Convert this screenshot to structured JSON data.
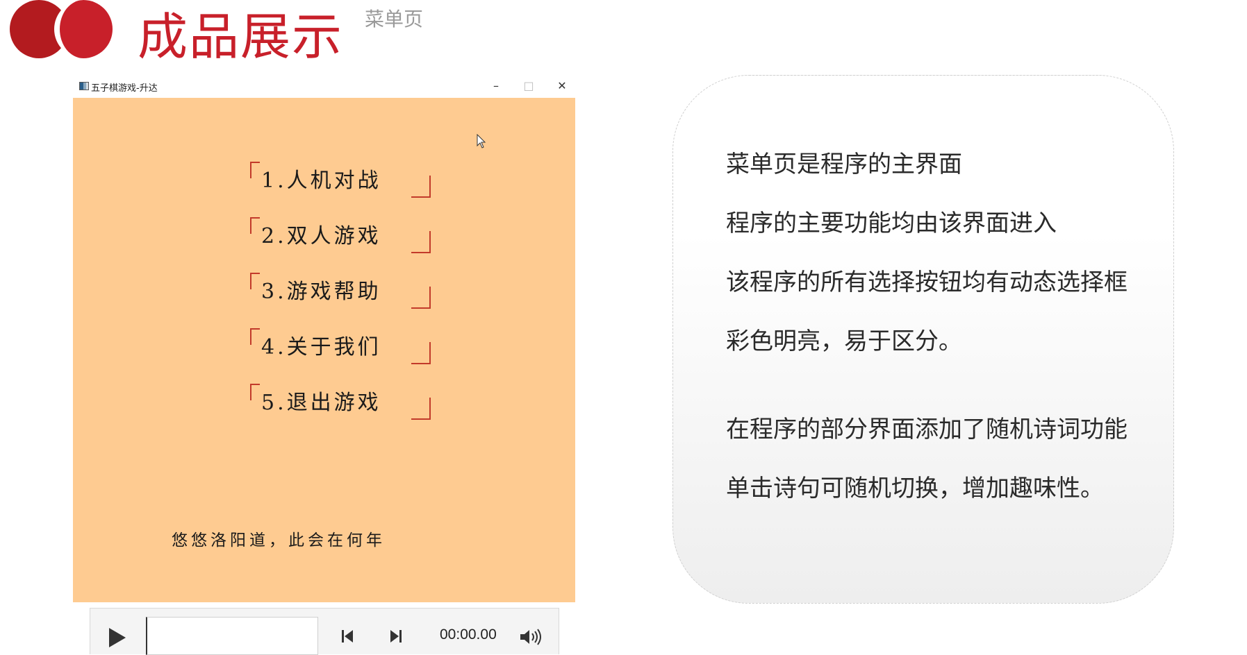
{
  "header": {
    "title": "成品展示",
    "subtitle": "菜单页"
  },
  "window": {
    "title": "五子棋游戏-升达",
    "minimize_glyph": "–",
    "maximize_glyph": "□",
    "close_glyph": "✕",
    "menu": [
      {
        "label": "1.人机对战"
      },
      {
        "label": "2.双人游戏"
      },
      {
        "label": "3.游戏帮助"
      },
      {
        "label": "4.关于我们"
      },
      {
        "label": "5.退出游戏"
      }
    ],
    "poem": "悠悠洛阳道，此会在何年",
    "background_color": "#fecb91",
    "bracket_color": "#c23a2a"
  },
  "media_player": {
    "time": "00:00.00",
    "icons": [
      "play-icon",
      "previous-icon",
      "next-icon",
      "volume-icon"
    ]
  },
  "description": {
    "lines": [
      "菜单页是程序的主界面",
      "程序的主要功能均由该界面进入",
      "该程序的所有选择按钮均有动态选择框",
      "彩色明亮，易于区分。",
      "在程序的部分界面添加了随机诗词功能",
      "单击诗句可随机切换，增加趣味性。"
    ]
  },
  "colors": {
    "accent": "#c8202a",
    "subtitle": "#9a9a9a"
  }
}
